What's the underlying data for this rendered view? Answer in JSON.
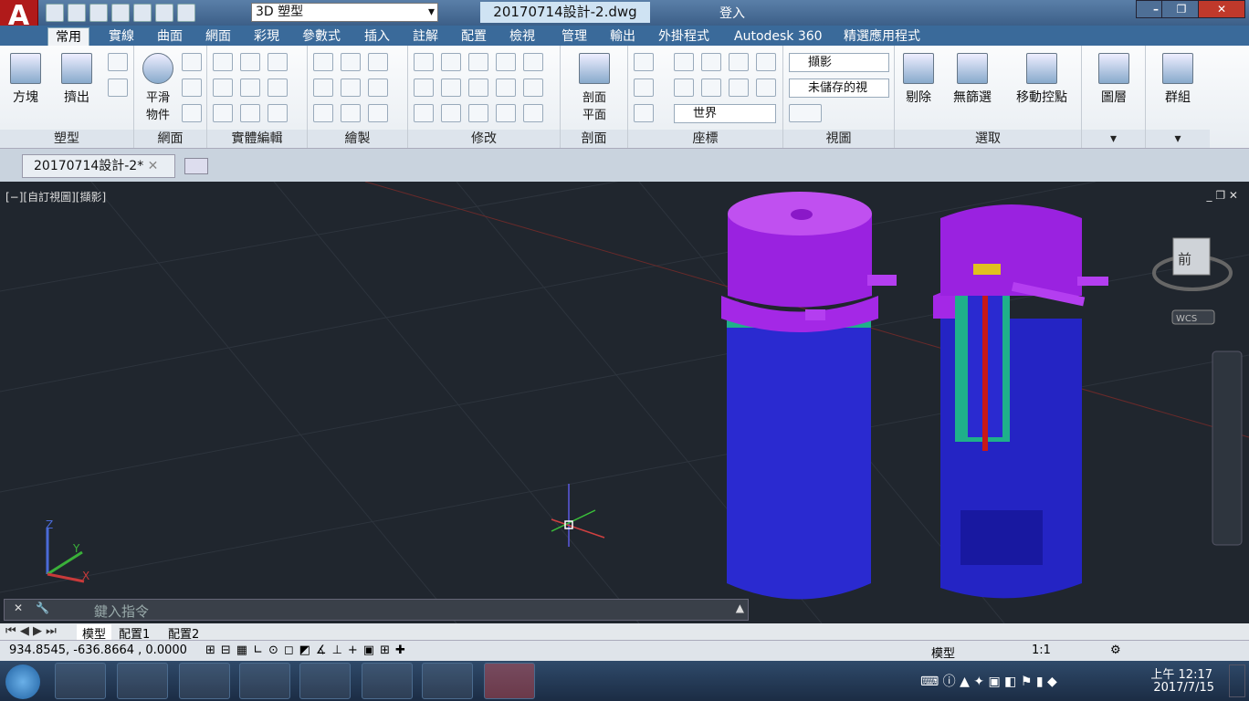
{
  "titlebar": {
    "workspace": "3D 塑型",
    "doc_title": "20170714設計-2.dwg",
    "login": "登入"
  },
  "tabs": [
    "常用",
    "實線",
    "曲面",
    "網面",
    "彩現",
    "參數式",
    "插入",
    "註解",
    "配置",
    "檢視",
    "管理",
    "輸出",
    "外掛程式",
    "Autodesk 360",
    "精選應用程式"
  ],
  "ribbon": {
    "box": "方塊",
    "extrude": "擠出",
    "smooth": "平滑\n物件",
    "section": "剖面\n平面",
    "remove": "剔除",
    "nofilter": "無篩選",
    "move_gizmo": "移動控點",
    "layers": "圖層",
    "group": "群組",
    "visual_style": "擷影",
    "unsaved_view": "未儲存的視",
    "world": "世界",
    "panels": [
      "塑型",
      "網面",
      "實體編輯",
      "繪製",
      "修改",
      "剖面",
      "座標",
      "視圖",
      "選取"
    ]
  },
  "doctab": "20170714設計-2*",
  "viewport": {
    "label": "[−][自訂視圖][擷影]",
    "viewcube": "前",
    "wcs": "WCS"
  },
  "command": {
    "placeholder": "鍵入指令"
  },
  "layouts": [
    "模型",
    "配置1",
    "配置2"
  ],
  "status": {
    "coords": "934.8545, -636.8664 , 0.0000",
    "model": "模型",
    "scale": "1:1"
  },
  "clock": {
    "time": "上午 12:17",
    "date": "2017/7/15"
  },
  "colors": {
    "accent": "#3a6a9a",
    "purple": "#a020e0",
    "blue": "#2020c8",
    "teal": "#20b090"
  }
}
